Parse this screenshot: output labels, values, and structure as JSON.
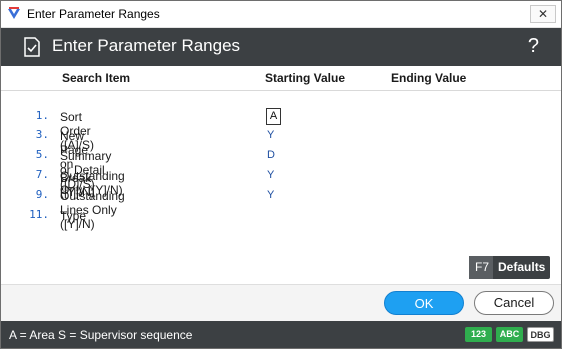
{
  "window": {
    "title": "Enter Parameter Ranges",
    "close_glyph": "✕"
  },
  "header": {
    "heading": "Enter Parameter Ranges",
    "help_glyph": "?"
  },
  "columns": {
    "search_item": "Search Item",
    "starting_value": "Starting Value",
    "ending_value": "Ending Value"
  },
  "rows": [
    {
      "num": "1.",
      "item": "Sort Order ([A]/S)",
      "start": "A"
    },
    {
      "num": "3.",
      "item": "New Page on Break ([Y]/N)",
      "start": "Y"
    },
    {
      "num": "5.",
      "item": "Summary or Detail ([D]/S)",
      "start": "D"
    },
    {
      "num": "7.",
      "item": "Outstanding Only ([Y]/N)",
      "start": "Y"
    },
    {
      "num": "9.",
      "item": "Outstanding Lines Only ([Y]/N)",
      "start": "Y"
    },
    {
      "num": "11.",
      "item": "Type",
      "start": ""
    }
  ],
  "defaults": {
    "key": "F7",
    "label": "Defaults"
  },
  "buttons": {
    "ok": "OK",
    "cancel": "Cancel"
  },
  "status": {
    "text": "A = Area S = Supervisor sequence",
    "badges": {
      "num": "123",
      "abc": "ABC",
      "dbg": "DBG"
    }
  },
  "colors": {
    "header_bg": "#3c4043",
    "accent": "#1ea0f2",
    "badge_green": "#2fae4e"
  },
  "icons": {
    "app": "app-logo-icon",
    "document": "document-check-icon",
    "help": "help-question-icon",
    "close": "close-icon"
  }
}
